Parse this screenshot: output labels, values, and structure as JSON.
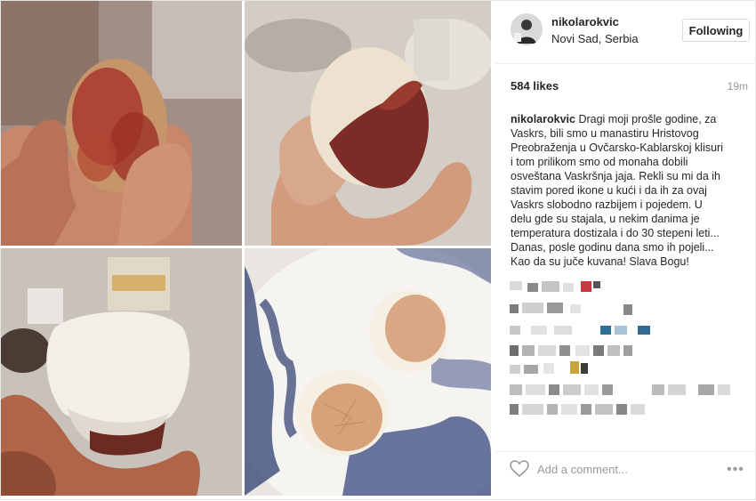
{
  "post": {
    "username": "nikolarokvic",
    "location": "Novi Sad, Serbia",
    "follow_label": "Following",
    "likes": "584 likes",
    "time": "19m",
    "caption_user": "nikolarokvic",
    "caption_lines": [
      "Dragi moji prošle godine, za",
      "Vaskrs, bili smo u manastiru Hristovog",
      "Preobraženja u Ovčarsko-Kablarskoj klisuri",
      "i tom prilikom smo od monaha dobili",
      "osveštana Vaskršnja jaja. Rekli su mi da ih",
      "stavim pored ikone u kući i da ih za ovaj",
      "Vaskrs slobodno razbijem i pojedem. U",
      "delu gde su stajala, u nekim danima je",
      "temperatura dostizala i do 30 stepeni leti...",
      "Danas, posle godinu dana smo ih pojeli...",
      "Kao da su juče kuvana! Slava Bogu!"
    ],
    "add_comment_placeholder": "Add a comment...",
    "more_icon": "•••",
    "icons": [
      "heart-icon",
      "more-options-icon"
    ]
  },
  "colors": {
    "text": "#262626",
    "muted": "#999999",
    "border": "#dbdbdb"
  }
}
